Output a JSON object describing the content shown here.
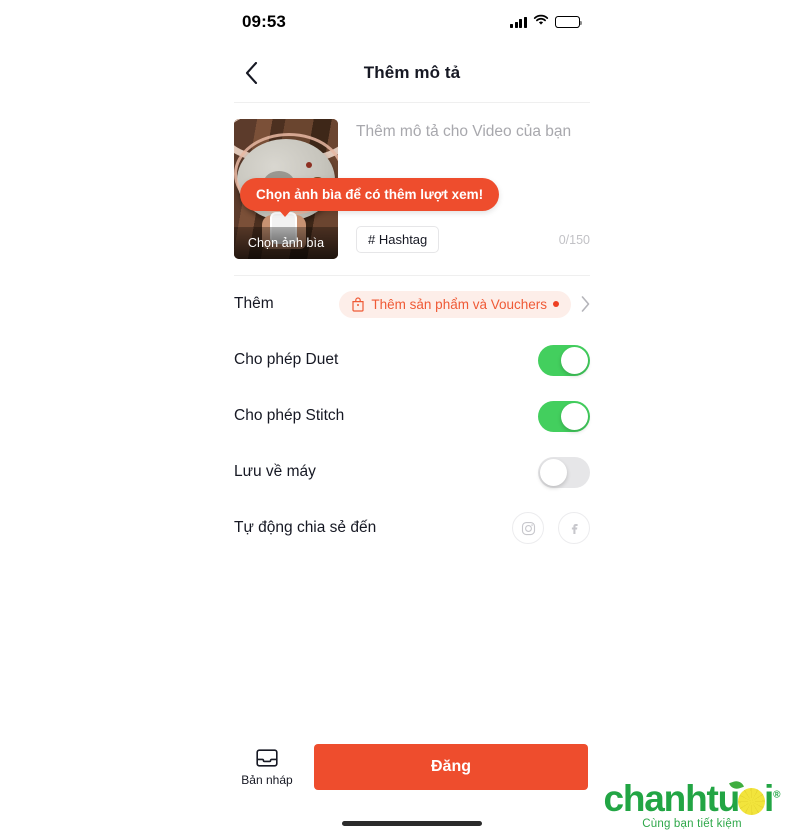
{
  "status_bar": {
    "time": "09:53",
    "signal_icon": "cellular-signal-icon",
    "wifi_icon": "wifi-icon",
    "battery_icon": "battery-icon"
  },
  "navbar": {
    "back_icon": "chevron-left-icon",
    "title": "Thêm mô tả"
  },
  "compose": {
    "thumbnail_label": "Chọn ảnh bìa",
    "description_placeholder": "Thêm mô tả cho Video của bạn",
    "hashtag_label": "# Hashtag",
    "char_count": "0/150",
    "tooltip": "Chọn ảnh bìa để có thêm lượt xem!"
  },
  "rows": {
    "add": {
      "label": "Thêm",
      "pill_label": "Thêm sản phẩm và Vouchers",
      "pill_icon": "shopping-bag-icon",
      "badge_dot": true,
      "chevron_icon": "chevron-right-icon"
    },
    "duet": {
      "label": "Cho phép Duet",
      "state": "on"
    },
    "stitch": {
      "label": "Cho phép Stitch",
      "state": "on"
    },
    "save_device": {
      "label": "Lưu về máy",
      "state": "off"
    },
    "auto_share": {
      "label": "Tự động chia sẻ đến",
      "instagram_icon": "instagram-icon",
      "facebook_icon": "facebook-icon"
    }
  },
  "bottom_bar": {
    "draft_label": "Bản nháp",
    "draft_icon": "inbox-tray-icon",
    "post_label": "Đăng"
  },
  "watermark": {
    "brand_part1": "chanhtu",
    "brand_part2": "i",
    "registered": "®",
    "tagline": "Cùng bạn tiết kiệm"
  },
  "colors": {
    "accent_orange": "#ee4d2d",
    "toggle_green": "#43cf5e",
    "toggle_off": "#e6e6e8",
    "pill_bg": "#fdeee9",
    "pill_text": "#ef5a36",
    "brand_green": "#22a544"
  }
}
